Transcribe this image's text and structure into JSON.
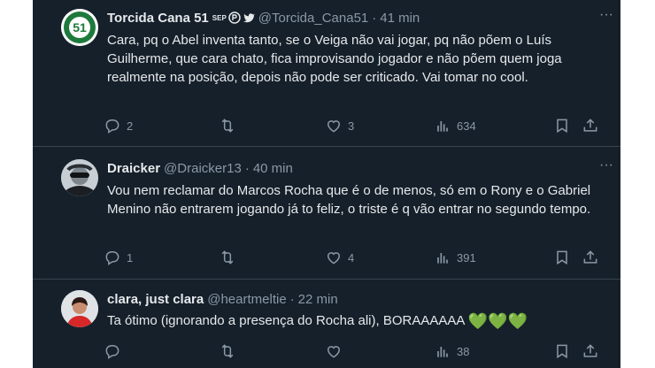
{
  "tweets": [
    {
      "name": "Torcida Cana 51",
      "handle": "@Torcida_Cana51",
      "dot": "·",
      "time": "41 min",
      "badge_text": "SEP",
      "avatar_text": "51",
      "body": "Cara, pq o Abel inventa tanto, se o Veiga não vai jogar, pq não põem o Luís Guilherme, que cara chato, fica improvisando jogador e não põem quem joga realmente na posição, depois não pode ser criticado. Vai tomar no cool.",
      "replies": "2",
      "retweets": "",
      "likes": "3",
      "views": "634"
    },
    {
      "name": "Draicker",
      "handle": "@Draicker13",
      "dot": "·",
      "time": "40 min",
      "body": "Vou nem reclamar do Marcos Rocha que é o de menos, só em o Rony e o Gabriel Menino não entrarem jogando já to feliz, o triste é q vão entrar no segundo tempo.",
      "replies": "1",
      "retweets": "",
      "likes": "4",
      "views": "391"
    },
    {
      "name": "clara, just clara",
      "handle": "@heartmeltie",
      "dot": "·",
      "time": "22 min",
      "body": "Ta ótimo (ignorando a presença do Rocha ali), BORAAAAAA",
      "hearts": "💚💚💚",
      "replies": "",
      "retweets": "",
      "likes": "",
      "views": "38"
    }
  ],
  "more_label": "···",
  "colors": {
    "background": "#15202b",
    "text": "#e7e9ea",
    "muted": "#8b98a5",
    "divider": "#38444d",
    "avatar_green": "#1e7a3c"
  }
}
